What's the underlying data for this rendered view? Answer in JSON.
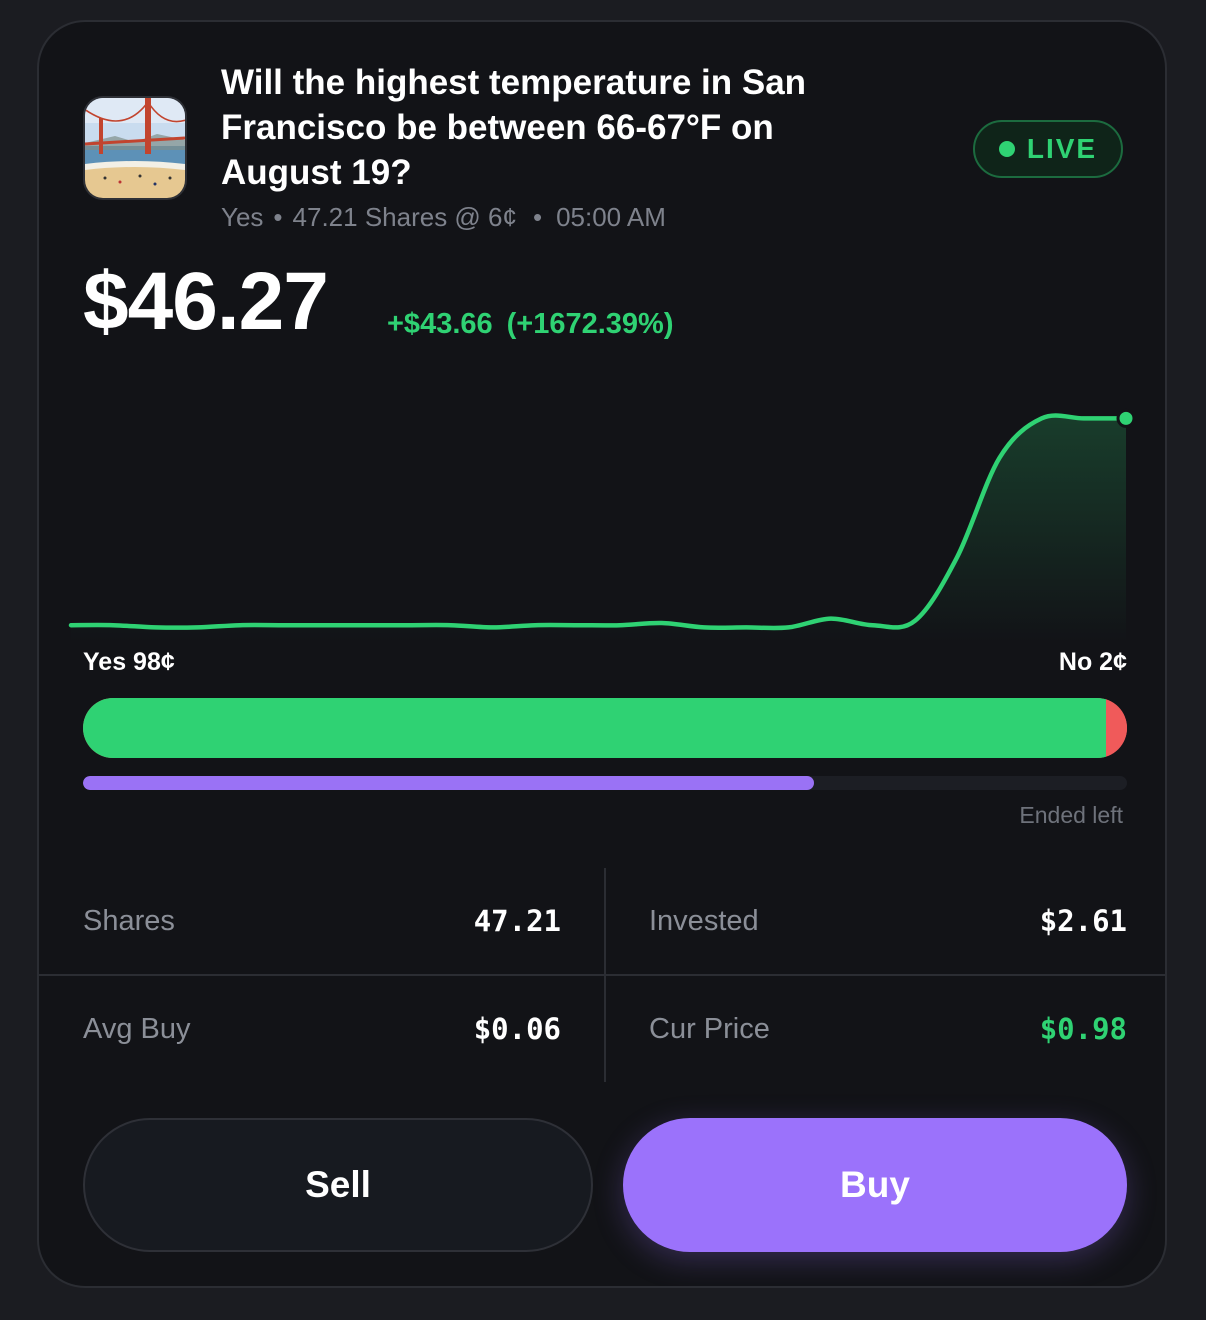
{
  "market": {
    "title": "Will the highest temperature in San Francisco be between 66-67°F on August 19?",
    "image_icon": "golden-gate-bridge-thumbnail",
    "meta": {
      "side": "Yes",
      "shares": "47.21 Shares @ 6¢",
      "time": "05:00 AM"
    },
    "status": "LIVE",
    "colors": {
      "accent_green": "#2fd273",
      "accent_red": "#f05a5a",
      "accent_purple": "#9b72fb"
    }
  },
  "position": {
    "value": "$46.27",
    "change_amount": "+$43.66",
    "change_pct": "(+1672.39%)"
  },
  "chart_data": {
    "type": "line",
    "title": "",
    "xlabel": "",
    "ylabel": "",
    "ylim": [
      0,
      1
    ],
    "grid": false,
    "series": [
      {
        "values": [
          0.04,
          0.04,
          0.03,
          0.03,
          0.04,
          0.04,
          0.04,
          0.04,
          0.04,
          0.04,
          0.03,
          0.04,
          0.04,
          0.04,
          0.05,
          0.03,
          0.03,
          0.03,
          0.07,
          0.04,
          0.06,
          0.35,
          0.8,
          0.98,
          0.98,
          0.98
        ]
      }
    ]
  },
  "probability": {
    "yes_label": "Yes 98¢",
    "no_label": "No 2¢",
    "yes": 0.98,
    "no": 0.02
  },
  "timeline": {
    "progress": 0.7,
    "label": "Ended left"
  },
  "stats": {
    "shares_label": "Shares",
    "shares_value": "47.21",
    "invested_label": "Invested",
    "invested_value": "$2.61",
    "avg_buy_label": "Avg Buy",
    "avg_buy_value": "$0.06",
    "cur_price_label": "Cur Price",
    "cur_price_value": "$0.98"
  },
  "actions": {
    "sell_label": "Sell",
    "buy_label": "Buy"
  }
}
